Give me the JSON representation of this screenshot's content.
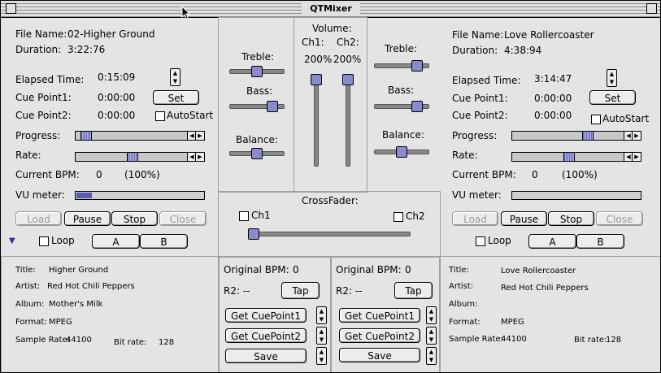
{
  "window": {
    "title": "QTMixer"
  },
  "deck1": {
    "file_name_label": "File Name:",
    "file_name": "02-Higher Ground",
    "duration_label": "Duration:",
    "duration": "3:22:76",
    "elapsed_label": "Elapsed Time:",
    "elapsed": "0:15:09",
    "cue1_label": "Cue Point1:",
    "cue1": "0:00:00",
    "cue2_label": "Cue Point2:",
    "cue2": "0:00:00",
    "set_label": "Set",
    "autostart_label": "AutoStart",
    "progress_label": "Progress:",
    "progress": 0.05,
    "rate_label": "Rate:",
    "rate": 0.5,
    "bpm_label": "Current BPM:",
    "bpm": "0",
    "bpm_pct": "(100%)",
    "vu_label": "VU meter:",
    "vu": 0.12,
    "load_label": "Load",
    "pause_label": "Pause",
    "stop_label": "Stop",
    "close_label": "Close",
    "loop_label": "Loop",
    "a_label": "A",
    "b_label": "B"
  },
  "deck2": {
    "file_name_label": "File Name:",
    "file_name": "Love Rollercoaster",
    "duration_label": "Duration:",
    "duration": "4:38:94",
    "elapsed_label": "Elapsed Time:",
    "elapsed": "3:14:47",
    "cue1_label": "Cue Point1:",
    "cue1": "0:00:00",
    "cue2_label": "Cue Point2:",
    "cue2": "0:00:00",
    "set_label": "Set",
    "autostart_label": "AutoStart",
    "progress_label": "Progress:",
    "progress": 0.68,
    "rate_label": "Rate:",
    "rate": 0.5,
    "bpm_label": "Current BPM:",
    "bpm": "0",
    "bpm_pct": "(100%)",
    "vu_label": "VU meter:",
    "vu": 0.0,
    "load_label": "Load",
    "pause_label": "Pause",
    "stop_label": "Stop",
    "close_label": "Close",
    "loop_label": "Loop",
    "a_label": "A",
    "b_label": "B"
  },
  "eq1": {
    "treble_label": "Treble:",
    "bass_label": "Bass:",
    "balance_label": "Balance:",
    "treble": 0.5,
    "bass": 0.85,
    "balance": 0.5
  },
  "eq2": {
    "treble_label": "Treble:",
    "bass_label": "Bass:",
    "balance_label": "Balance:",
    "treble": 0.85,
    "bass": 0.85,
    "balance": 0.5
  },
  "volume": {
    "label": "Volume:",
    "ch1_label": "Ch1:",
    "ch2_label": "Ch2:",
    "ch1_value": "200%",
    "ch2_value": "200%",
    "ch1": 1.0,
    "ch2": 1.0
  },
  "crossfader": {
    "label": "CrossFader:",
    "ch1_label": "Ch1",
    "ch2_label": "Ch2",
    "position": 0.0
  },
  "meta1": {
    "title_label": "Title:",
    "title": "Higher Ground",
    "artist_label": "Artist:",
    "artist": "Red Hot Chili Peppers",
    "album_label": "Album:",
    "album": "Mother's Milk",
    "format_label": "Format:",
    "format": "MPEG",
    "sample_rate_label": "Sample Rate:",
    "sample_rate": "44100",
    "bit_rate_label": "Bit rate:",
    "bit_rate": "128"
  },
  "meta2": {
    "title_label": "Title:",
    "title": "Love Rollercoaster",
    "artist_label": "Artist:",
    "artist": "Red Hot Chili Peppers",
    "album_label": "Album:",
    "album": "",
    "format_label": "Format:",
    "format": "MPEG",
    "sample_rate_label": "Sample Rate:",
    "sample_rate": "44100",
    "bit_rate_label": "Bit rate:",
    "bit_rate": "128"
  },
  "bpm1": {
    "original_label": "Original BPM:",
    "original": "0",
    "r2_label": "R2: --",
    "tap_label": "Tap",
    "get1_label": "Get CuePoint1",
    "get2_label": "Get CuePoint2",
    "save_label": "Save"
  },
  "bpm2": {
    "original_label": "Original BPM:",
    "original": "0",
    "r2_label": "R2: --",
    "tap_label": "Tap",
    "get1_label": "Get CuePoint1",
    "get2_label": "Get CuePoint2",
    "save_label": "Save"
  }
}
